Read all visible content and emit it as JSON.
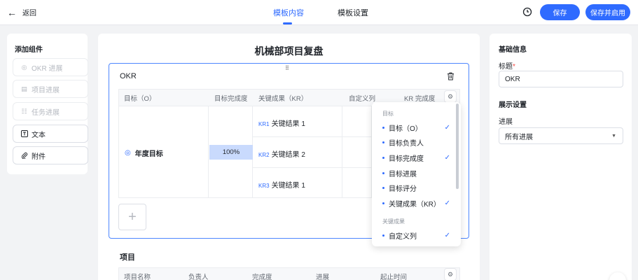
{
  "header": {
    "back_label": "返回",
    "tabs": [
      {
        "label": "模板内容",
        "active": true
      },
      {
        "label": "模板设置",
        "active": false
      }
    ],
    "save_label": "保存",
    "save_enable_label": "保存并启用",
    "accent_color": "#2f6bff"
  },
  "left_panel": {
    "title": "添加组件",
    "components": [
      {
        "label": "OKR 进展",
        "icon": "target-icon",
        "enabled": false
      },
      {
        "label": "项目进展",
        "icon": "list-icon",
        "enabled": false
      },
      {
        "label": "任务进展",
        "icon": "checklist-icon",
        "enabled": false
      },
      {
        "label": "文本",
        "icon": "text-icon",
        "enabled": true
      },
      {
        "label": "附件",
        "icon": "paperclip-icon",
        "enabled": true
      }
    ]
  },
  "canvas": {
    "document_title": "机械部项目复盘",
    "okr_block": {
      "label": "OKR",
      "columns": [
        "目标（O）",
        "目标完成度",
        "关键成果（KR）",
        "自定义列",
        "KR 完成度"
      ],
      "objective": "年度目标",
      "objective_progress": "100%",
      "key_results": [
        {
          "tag": "KR1",
          "text": "关键结果 1"
        },
        {
          "tag": "KR2",
          "text": "关键结果 2"
        },
        {
          "tag": "KR3",
          "text": "关键结果 1"
        }
      ],
      "add_symbol": "+"
    },
    "project_block": {
      "label": "项目",
      "columns": [
        "项目名称",
        "负责人",
        "完成度",
        "进展",
        "起止时间"
      ]
    }
  },
  "column_menu": {
    "groups": [
      {
        "title": "目标",
        "items": [
          {
            "label": "目标（O）",
            "checked": true
          },
          {
            "label": "目标负责人",
            "checked": false
          },
          {
            "label": "目标完成度",
            "checked": true
          },
          {
            "label": "目标进展",
            "checked": false
          },
          {
            "label": "目标评分",
            "checked": false
          },
          {
            "label": "关键成果（KR）",
            "checked": true
          }
        ]
      },
      {
        "title": "关键成果",
        "items": [
          {
            "label": "自定义列",
            "checked": true
          }
        ]
      }
    ]
  },
  "right_panel": {
    "basic_heading": "基础信息",
    "title_label": "标题",
    "title_required_mark": "*",
    "title_value": "OKR",
    "display_heading": "展示设置",
    "progress_label": "进展",
    "progress_value": "所有进展"
  }
}
